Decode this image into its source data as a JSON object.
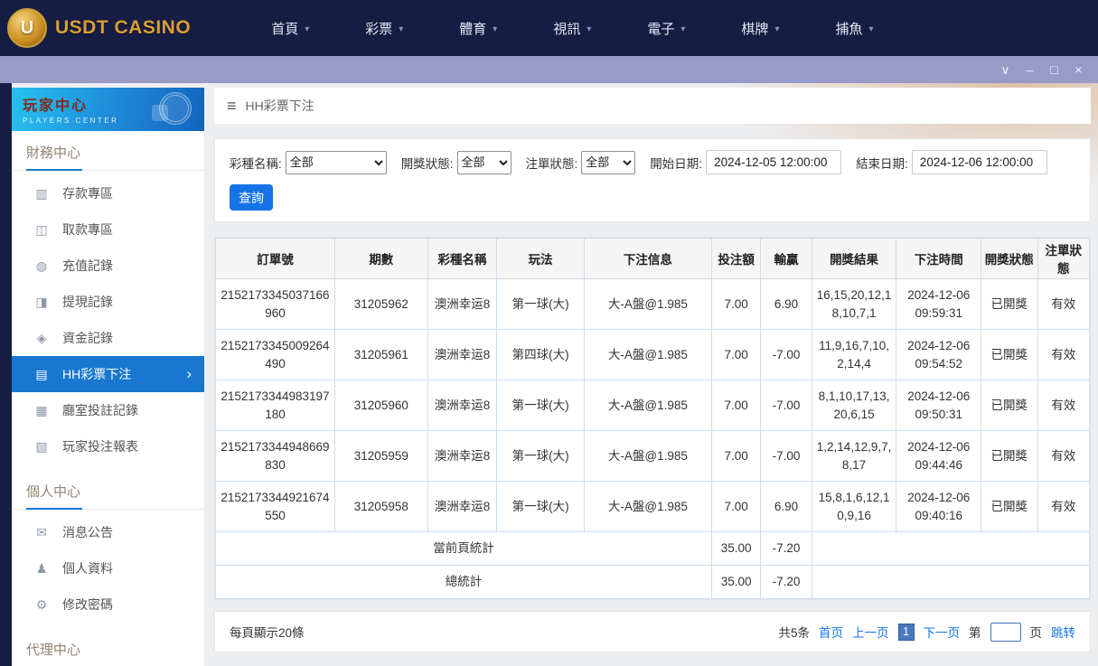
{
  "topnav": {
    "logo_monogram": "U",
    "logo_text": "USDT CASINO",
    "items": [
      "首頁",
      "彩票",
      "體育",
      "視訊",
      "電子",
      "棋牌",
      "捕魚"
    ]
  },
  "sidebar": {
    "title": "玩家中心",
    "subtitle": "PLAYERS CENTER",
    "sections": [
      {
        "title": "財務中心",
        "items": [
          {
            "label": "存款專區",
            "icon": "deposit",
            "active": false
          },
          {
            "label": "取款專區",
            "icon": "withdraw",
            "active": false
          },
          {
            "label": "充值記錄",
            "icon": "recharge",
            "active": false
          },
          {
            "label": "提現記錄",
            "icon": "withdrawal-record",
            "active": false
          },
          {
            "label": "資金記錄",
            "icon": "funds",
            "active": false
          },
          {
            "label": "HH彩票下注",
            "icon": "lottery-bets",
            "active": true
          },
          {
            "label": "廳室投註記錄",
            "icon": "hall-bets",
            "active": false
          },
          {
            "label": "玩家投注報表",
            "icon": "bet-report",
            "active": false
          }
        ]
      },
      {
        "title": "個人中心",
        "items": [
          {
            "label": "消息公告",
            "icon": "announcement",
            "active": false
          },
          {
            "label": "個人資料",
            "icon": "profile",
            "active": false
          },
          {
            "label": "修改密碼",
            "icon": "password",
            "active": false
          }
        ]
      },
      {
        "title": "代理中心",
        "items": []
      }
    ]
  },
  "main": {
    "breadcrumb": "HH彩票下注",
    "filters": {
      "lottery_label": "彩種名稱:",
      "lottery_value": "全部",
      "draw_status_label": "開獎狀態:",
      "draw_status_value": "全部",
      "bet_status_label": "注單狀態:",
      "bet_status_value": "全部",
      "start_label": "開始日期:",
      "start_value": "2024-12-05 12:00:00",
      "end_label": "結束日期:",
      "end_value": "2024-12-06 12:00:00",
      "search_button": "查詢"
    },
    "table": {
      "headers": [
        "訂單號",
        "期數",
        "彩種名稱",
        "玩法",
        "下注信息",
        "投注額",
        "輸贏",
        "開獎結果",
        "下注時間",
        "開獎狀態",
        "注單狀態"
      ],
      "rows": [
        [
          "2152173345037166960",
          "31205962",
          "澳洲幸运8",
          "第一球(大)",
          "大-A盤@1.985",
          "7.00",
          "6.90",
          "16,15,20,12,18,10,7,1",
          "2024-12-06 09:59:31",
          "已開獎",
          "有效"
        ],
        [
          "2152173345009264490",
          "31205961",
          "澳洲幸运8",
          "第四球(大)",
          "大-A盤@1.985",
          "7.00",
          "-7.00",
          "11,9,16,7,10,2,14,4",
          "2024-12-06 09:54:52",
          "已開獎",
          "有效"
        ],
        [
          "2152173344983197180",
          "31205960",
          "澳洲幸运8",
          "第一球(大)",
          "大-A盤@1.985",
          "7.00",
          "-7.00",
          "8,1,10,17,13,20,6,15",
          "2024-12-06 09:50:31",
          "已開獎",
          "有效"
        ],
        [
          "2152173344948669830",
          "31205959",
          "澳洲幸运8",
          "第一球(大)",
          "大-A盤@1.985",
          "7.00",
          "-7.00",
          "1,2,14,12,9,7,8,17",
          "2024-12-06 09:44:46",
          "已開獎",
          "有效"
        ],
        [
          "2152173344921674550",
          "31205958",
          "澳洲幸运8",
          "第一球(大)",
          "大-A盤@1.985",
          "7.00",
          "6.90",
          "15,8,1,6,12,10,9,16",
          "2024-12-06 09:40:16",
          "已開獎",
          "有效"
        ]
      ],
      "page_total_label": "當前頁統計",
      "page_total_bet": "35.00",
      "page_total_win": "-7.20",
      "grand_total_label": "總統計",
      "grand_total_bet": "35.00",
      "grand_total_win": "-7.20"
    },
    "pagination": {
      "per_page": "每頁顯示20條",
      "total": "共5条",
      "first": "首页",
      "prev": "上一页",
      "current": "1",
      "next": "下一页",
      "page_prefix": "第",
      "page_suffix": "页",
      "jump": "跳转"
    }
  },
  "colors": {
    "navy": "#151d42",
    "titlebar_purple": "#989ac7",
    "accent_blue": "#1673e6",
    "sidebar_active_blue": "#1878d0",
    "logo_gold": "#d99f35"
  }
}
